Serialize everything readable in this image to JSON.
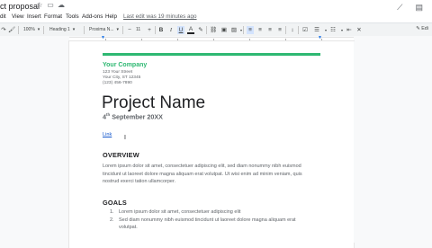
{
  "title_bar": {
    "doc_title": "ct proposal",
    "icons": [
      "star-icon",
      "move-to-folder-icon",
      "cloud-status-icon"
    ],
    "right_icons": [
      "activity-trend-icon",
      "comment-icon"
    ]
  },
  "menu": {
    "items": [
      "dit",
      "View",
      "Insert",
      "Format",
      "Tools",
      "Add-ons",
      "Help"
    ],
    "last_edit": "Last edit was 19 minutes ago"
  },
  "toolbar": {
    "zoom": "100%",
    "style": "Heading 1",
    "font": "Proxima N...",
    "font_size": "11",
    "edit_label": "Edi"
  },
  "document": {
    "company": "Your Company",
    "address": [
      "123 Your Street",
      "Your City, ST 12345",
      "(123) 456-7890"
    ],
    "project_name": "Project Name",
    "date_day": "4",
    "date_suffix": "th",
    "date_rest": " September 20XX",
    "link_text": "Link",
    "overview_heading": "OVERVIEW",
    "overview_text": "Lorem ipsum dolor sit amet, consectetuer adipiscing elit, sed diam nonummy nibh euismod tincidunt ut laoreet dolore magna aliquam erat volutpat. Ut wisi enim ad minim veniam, quis nostrud exerci tation ullamcorper.",
    "goals_heading": "GOALS",
    "goals": [
      "Lorem ipsum dolor sit amet, consectetuer adipiscing elit",
      "Sed diam nonummy nibh euismod tincidunt ut laoreet dolore magna aliquam erat volutpat."
    ]
  },
  "colors": {
    "accent_green": "#2eb872",
    "link_blue": "#1155cc",
    "ruler_blue": "#1a73e8"
  }
}
